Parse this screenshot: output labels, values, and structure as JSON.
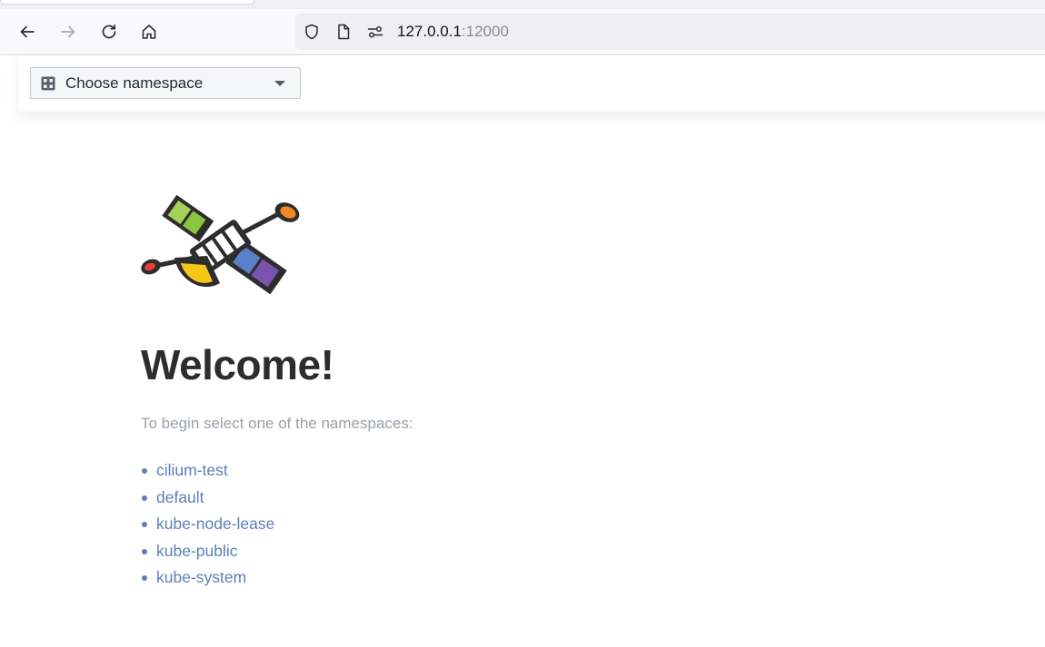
{
  "browser": {
    "url_host": "127.0.0.1",
    "url_port": ":12000",
    "icons": {
      "back": "back-arrow-icon",
      "forward": "forward-arrow-icon",
      "reload": "reload-icon",
      "home": "home-icon",
      "tracking": "shield-icon",
      "page_info": "page-icon",
      "permissions": "permissions-icon"
    }
  },
  "header": {
    "namespace_select": {
      "label": "Choose namespace",
      "icon": "namespace-icon"
    }
  },
  "main": {
    "logo": "satellite-logo",
    "title": "Welcome!",
    "subtitle": "To begin select one of the namespaces:",
    "namespaces": [
      {
        "label": "cilium-test"
      },
      {
        "label": "default"
      },
      {
        "label": "kube-node-lease"
      },
      {
        "label": "kube-public"
      },
      {
        "label": "kube-system"
      }
    ]
  },
  "colors": {
    "link": "#5b80b8",
    "title": "#2d2d2d",
    "subtitle": "#9aa0a6",
    "accent_orange": "#f08a24",
    "accent_red": "#e8403a",
    "accent_green": "#8cc63f",
    "accent_yellow": "#f5c518",
    "accent_blue": "#5b80c8",
    "accent_purple": "#7b52ae"
  }
}
